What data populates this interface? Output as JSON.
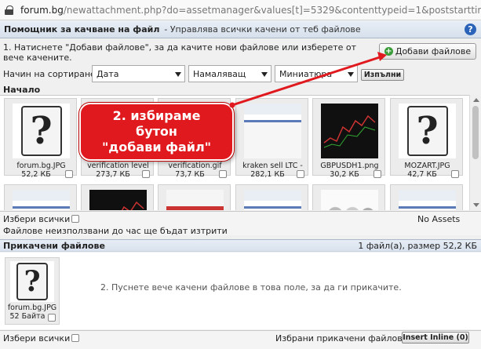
{
  "browser": {
    "url_host": "forum.bg",
    "url_path": "/newattachment.php?do=assetmanager&values[t]=5329&contenttypeid=1&poststarttime..."
  },
  "header": {
    "title": "Помощник за качване на файл",
    "subtitle": "- Управлява всички качени от теб файлове",
    "help_label": "?"
  },
  "instructions": "1. Натиснете \"Добави файлове\", за да качите нови файлове или изберете от вече качените.",
  "add_button_label": "Добави файлове",
  "sort": {
    "label": "Начин на сортиране:",
    "field": "Дата",
    "order": "Намаляващ",
    "view": "Миниатюра",
    "apply_label": "Изпълни"
  },
  "breadcrumb": "Начало",
  "assets": [
    {
      "name": "forum.bg.JPG",
      "size": "52,2 КБ",
      "thumb": "question"
    },
    {
      "name": "verification level",
      "size": "273,7 КБ",
      "thumb": "screenshot-dark"
    },
    {
      "name": "verification.gif",
      "size": "73,7 КБ",
      "thumb": "screenshot-dark"
    },
    {
      "name": "kraken sell LTC -",
      "size": "282,1 КБ",
      "thumb": "screenshot-light"
    },
    {
      "name": "GBPUSDH1.png",
      "size": "30,2 КБ",
      "thumb": "chart-dark"
    },
    {
      "name": "MOZART.JPG",
      "size": "42,7 КБ",
      "thumb": "question"
    },
    {
      "name": "",
      "size": "",
      "thumb": "screenshot-light"
    },
    {
      "name": "",
      "size": "",
      "thumb": "chart-dark"
    },
    {
      "name": "",
      "size": "",
      "thumb": "screenshot-red"
    },
    {
      "name": "",
      "size": "",
      "thumb": "screenshot-light"
    },
    {
      "name": "",
      "size": "",
      "thumb": "coins"
    },
    {
      "name": "",
      "size": "",
      "thumb": "screenshot-light"
    }
  ],
  "asset_footer": {
    "select_all": "Избери всички",
    "no_assets": "No Assets",
    "notice": "Файлове неизползвани до час ще бъдат изтрити"
  },
  "attached": {
    "title": "Прикачени файлове",
    "summary": "1 файл(а), размер 52,2 КБ",
    "file_name": "forum.bg.JPG",
    "file_size": "52 Байта",
    "hint": "2. Пуснете вече качени файлове в това поле, за да ги прикачите."
  },
  "bottom": {
    "select_all": "Избери всички",
    "selected_label": "Избрани прикачени файлове:",
    "insert_inline_label": "Insert Inline (0)"
  },
  "callout": {
    "line1": "2. избираме",
    "line2": "бутон",
    "line3": "\"добави файл\""
  }
}
